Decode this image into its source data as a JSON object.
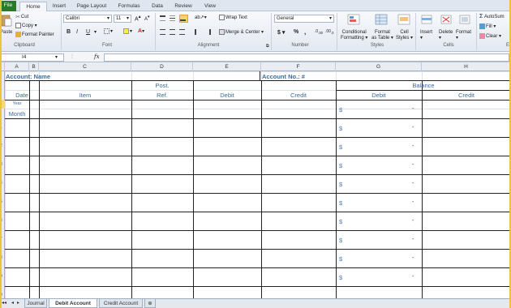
{
  "ribbon_tabs": [
    "File",
    "Home",
    "Insert",
    "Page Layout",
    "Formulas",
    "Data",
    "Review",
    "View"
  ],
  "clipboard": {
    "paste": "Paste",
    "cut": "Cut",
    "copy": "Copy",
    "format_painter": "Format Painter",
    "label": "Clipboard"
  },
  "font": {
    "name": "Calibri",
    "size": "11",
    "bold": "B",
    "italic": "I",
    "underline": "U",
    "label": "Font"
  },
  "alignment": {
    "wrap_text": "Wrap Text",
    "merge_center": "Merge & Center",
    "label": "Alignment"
  },
  "number": {
    "format": "General",
    "currency": "$",
    "percent": "%",
    "comma": ",",
    "label": "Number"
  },
  "styles": {
    "conditional": "Conditional",
    "conditional2": "Formatting",
    "format_as": "Format",
    "format_as2": "as Table",
    "cell": "Cell",
    "cell2": "Styles",
    "label": "Styles"
  },
  "cells": {
    "insert": "Insert",
    "delete": "Delete",
    "format": "Format",
    "label": "Cells"
  },
  "editing": {
    "autosum": "AutoSum",
    "fill": "Fill",
    "clear": "Clear",
    "label": "E"
  },
  "formula_bar": {
    "name_box": "I4",
    "fx": "fx"
  },
  "columns": [
    "A",
    "B",
    "C",
    "D",
    "E",
    "F",
    "G",
    "H"
  ],
  "sheet": {
    "account_name": "Account: Name",
    "account_no": "Account No.: #",
    "balance": "Balance",
    "post": "Post.",
    "date": "Date",
    "item": "Item",
    "ref": "Ref.",
    "debit": "Debit",
    "credit": "Credit",
    "bal_debit": "Debit",
    "bal_credit": "Credit",
    "year": "Year",
    "month": "Month",
    "dollar": "$",
    "dash": "-"
  },
  "sheet_tabs": [
    "Journal",
    "Debit Account",
    "Credit Account"
  ],
  "colors": {
    "accent_text": "#3d6c9e",
    "file_tab": "#2b7a2b",
    "ribbon": "#e3e9f1"
  }
}
